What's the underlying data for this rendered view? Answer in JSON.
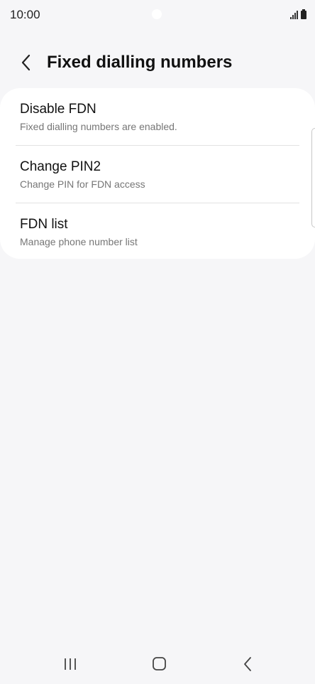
{
  "status_bar": {
    "time": "10:00",
    "icons": [
      "camera-cutout",
      "signal-icon",
      "battery-icon"
    ]
  },
  "header": {
    "back_icon": "chevron-left-icon",
    "title": "Fixed dialling numbers"
  },
  "menu": {
    "items": [
      {
        "title": "Disable FDN",
        "subtitle": "Fixed dialling numbers are enabled."
      },
      {
        "title": "Change PIN2",
        "subtitle": "Change PIN for FDN access"
      },
      {
        "title": "FDN list",
        "subtitle": "Manage phone number list"
      }
    ]
  },
  "nav_bar": {
    "icons": [
      "recent-apps-icon",
      "home-icon",
      "back-icon"
    ]
  },
  "colors": {
    "background": "#f6f6f8",
    "card": "#ffffff",
    "subtitle": "#767676",
    "divider": "#e2e2e2"
  }
}
